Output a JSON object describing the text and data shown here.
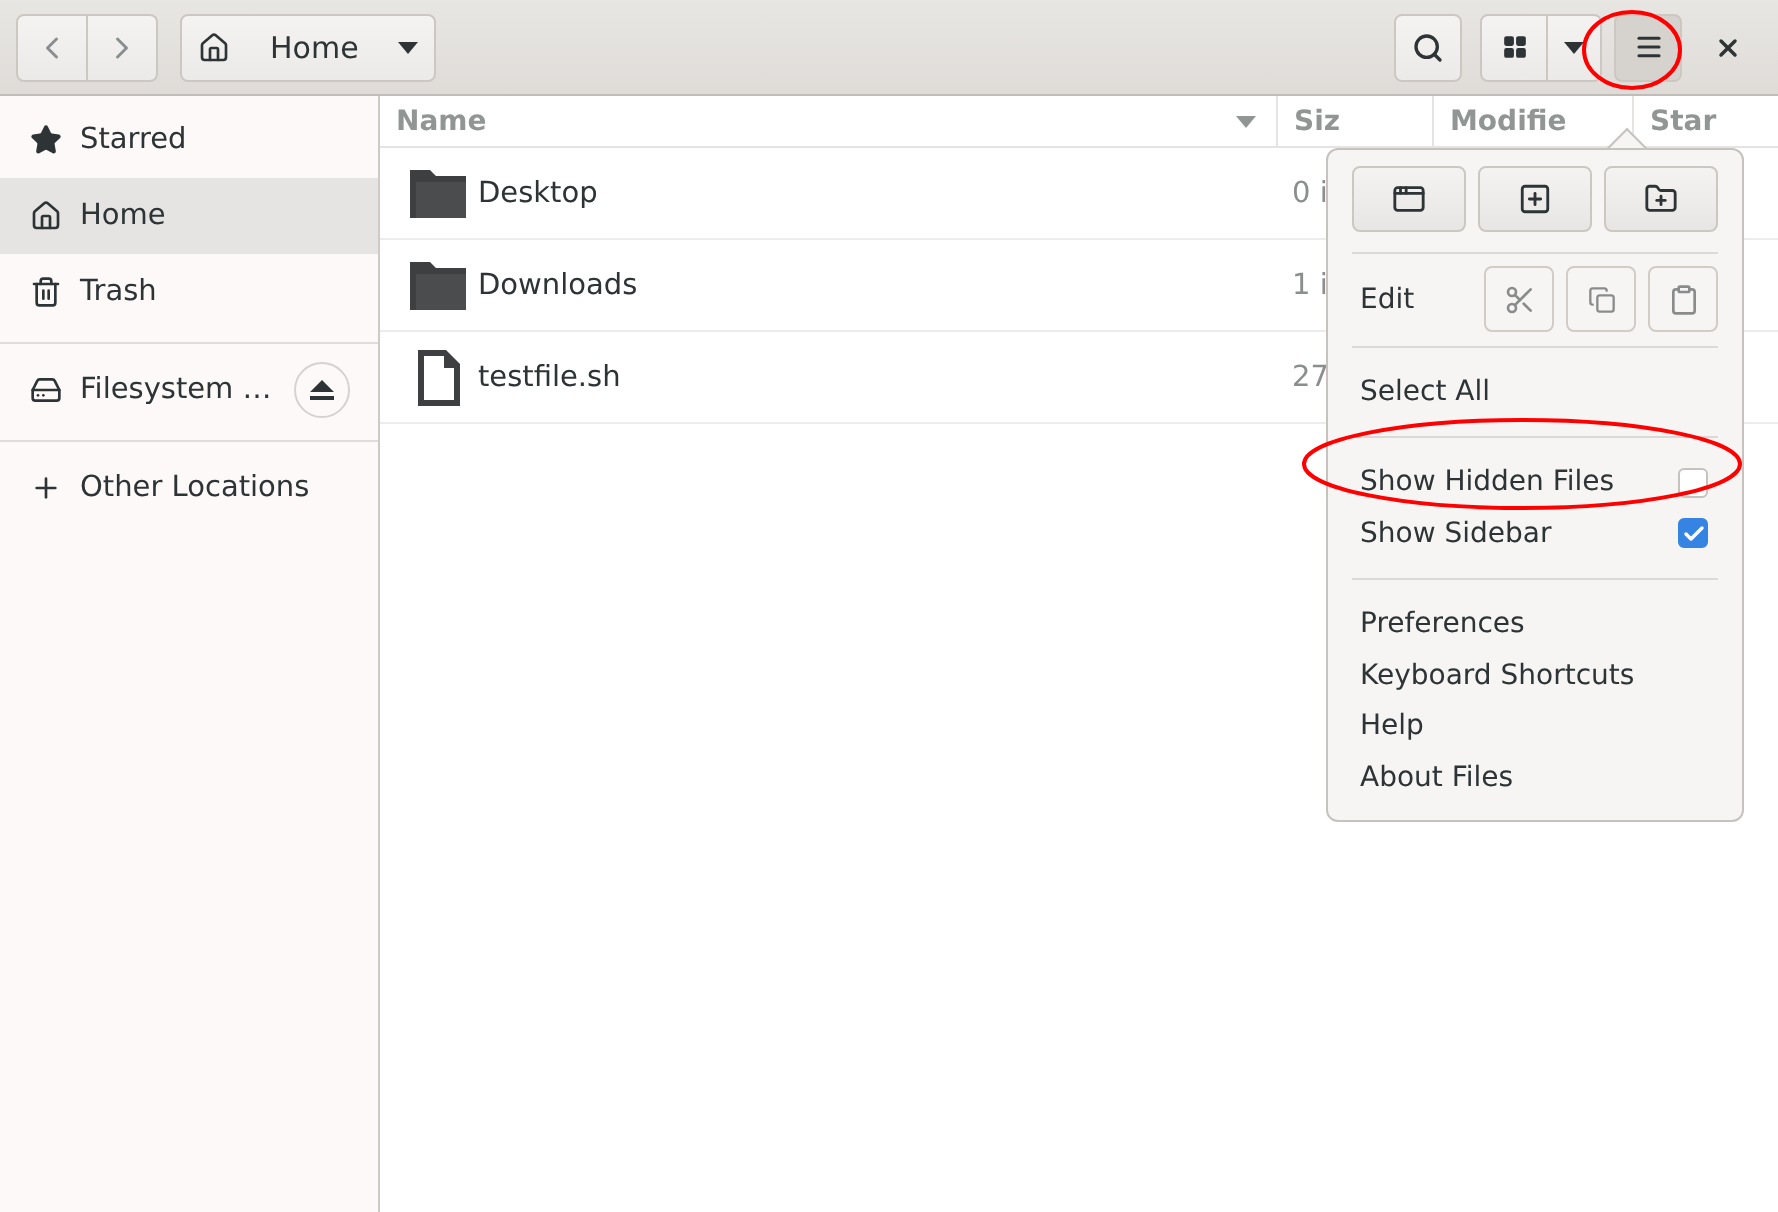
{
  "toolbar": {
    "path_label": "Home"
  },
  "sidebar": {
    "sections": [
      {
        "items": [
          {
            "kind": "starred",
            "label": "Starred",
            "selected": false
          },
          {
            "kind": "home",
            "label": "Home",
            "selected": true
          },
          {
            "kind": "trash",
            "label": "Trash",
            "selected": false
          }
        ]
      },
      {
        "items": [
          {
            "kind": "drive",
            "label": "Filesystem …",
            "selected": false,
            "ejectable": true
          }
        ]
      },
      {
        "items": [
          {
            "kind": "other",
            "label": "Other Locations",
            "selected": false
          }
        ]
      }
    ]
  },
  "table": {
    "columns": [
      "Name",
      "Siz",
      "Modifie",
      "Star"
    ],
    "rows": [
      {
        "kind": "folder",
        "name": "Desktop",
        "size": "0 i"
      },
      {
        "kind": "folder",
        "name": "Downloads",
        "size": "1 i"
      },
      {
        "kind": "file",
        "name": "testfile.sh",
        "size": "27"
      }
    ]
  },
  "menu": {
    "edit_label": "Edit",
    "items": [
      {
        "kind": "action",
        "label": "Select All"
      },
      {
        "kind": "separator"
      },
      {
        "kind": "check",
        "label": "Show Hidden Files",
        "checked": false
      },
      {
        "kind": "check",
        "label": "Show Sidebar",
        "checked": true
      },
      {
        "kind": "separator"
      },
      {
        "kind": "action",
        "label": "Preferences"
      },
      {
        "kind": "action",
        "label": "Keyboard Shortcuts"
      },
      {
        "kind": "action",
        "label": "Help"
      },
      {
        "kind": "action",
        "label": "About Files"
      }
    ]
  }
}
